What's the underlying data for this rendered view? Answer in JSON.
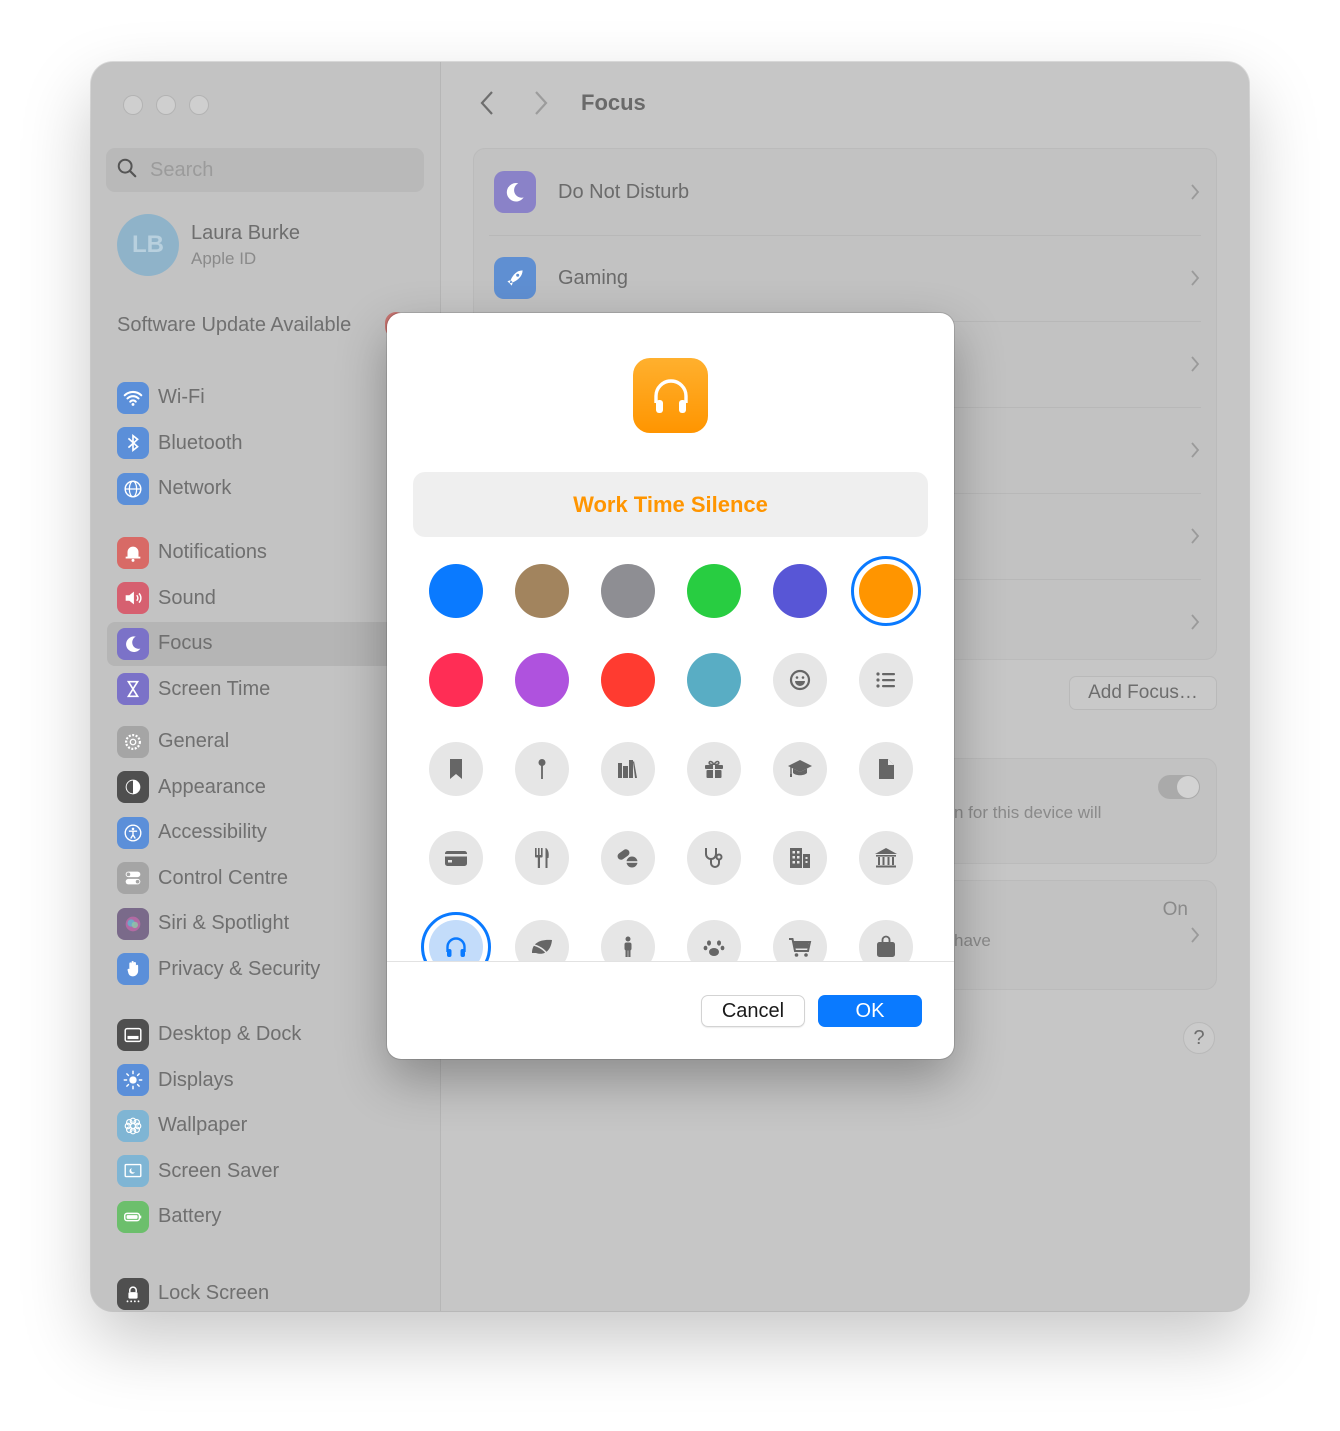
{
  "window": {
    "traffic_lights": [
      "close",
      "minimize",
      "zoom"
    ]
  },
  "sidebar": {
    "search_placeholder": "Search",
    "account": {
      "initials": "LB",
      "name": "Laura Burke",
      "subtitle": "Apple ID"
    },
    "software_update": "Software Update Available",
    "groups": [
      [
        {
          "label": "Wi-Fi",
          "icon": "wifi-icon",
          "color": "#5b8fd9"
        },
        {
          "label": "Bluetooth",
          "icon": "bluetooth-icon",
          "color": "#5b8fd9"
        },
        {
          "label": "Network",
          "icon": "globe-icon",
          "color": "#5b8fd9"
        }
      ],
      [
        {
          "label": "Notifications",
          "icon": "bell-icon",
          "color": "#d86a66"
        },
        {
          "label": "Sound",
          "icon": "speaker-icon",
          "color": "#d66070"
        },
        {
          "label": "Focus",
          "icon": "moon-icon",
          "color": "#7b72c8",
          "active": true
        },
        {
          "label": "Screen Time",
          "icon": "hourglass-icon",
          "color": "#7b72c8"
        }
      ],
      [
        {
          "label": "General",
          "icon": "gear-icon",
          "color": "#a5a5a5"
        },
        {
          "label": "Appearance",
          "icon": "appearance-icon",
          "color": "#4f4f4f"
        },
        {
          "label": "Accessibility",
          "icon": "accessibility-icon",
          "color": "#5b8fd9"
        },
        {
          "label": "Control Centre",
          "icon": "switches-icon",
          "color": "#a5a5a5"
        },
        {
          "label": "Siri & Spotlight",
          "icon": "siri-icon",
          "color": "#7a6a8a"
        },
        {
          "label": "Privacy & Security",
          "icon": "hand-icon",
          "color": "#5b8fd9"
        }
      ],
      [
        {
          "label": "Desktop & Dock",
          "icon": "dock-icon",
          "color": "#4f4f4f"
        },
        {
          "label": "Displays",
          "icon": "sun-icon",
          "color": "#5b8fd9"
        },
        {
          "label": "Wallpaper",
          "icon": "flower-icon",
          "color": "#7fb5d4"
        },
        {
          "label": "Screen Saver",
          "icon": "screensaver-icon",
          "color": "#7fb5d4"
        },
        {
          "label": "Battery",
          "icon": "battery-icon",
          "color": "#6cbf6c"
        }
      ],
      [
        {
          "label": "Lock Screen",
          "icon": "lock-icon",
          "color": "#4f4f4f"
        }
      ]
    ]
  },
  "content": {
    "title": "Focus",
    "focus_items": [
      {
        "label": "Do Not Disturb",
        "icon": "moon-icon",
        "color": "#8a82c8"
      },
      {
        "label": "Gaming",
        "icon": "rocket-icon",
        "color": "#5f8fd2"
      },
      {
        "label": "",
        "icon": "",
        "color": ""
      },
      {
        "label": "",
        "icon": "",
        "color": ""
      },
      {
        "label": "",
        "icon": "",
        "color": ""
      },
      {
        "label": "",
        "icon": "",
        "color": ""
      }
    ],
    "add_focus_label": "Add Focus…",
    "share_text": "n for this device will",
    "status_value": "On",
    "status_text": "have",
    "help_label": "?"
  },
  "modal": {
    "selected_icon": "headphones-icon",
    "accent_color": "#ff9500",
    "name_value": "Work Time Silence",
    "colors": [
      {
        "name": "blue",
        "hex": "#0a7aff"
      },
      {
        "name": "brown",
        "hex": "#a2845e"
      },
      {
        "name": "gray",
        "hex": "#8e8e93"
      },
      {
        "name": "green",
        "hex": "#28cd41"
      },
      {
        "name": "indigo",
        "hex": "#5856d6"
      },
      {
        "name": "orange",
        "hex": "#ff9500",
        "selected": true
      },
      {
        "name": "pink",
        "hex": "#ff2d55"
      },
      {
        "name": "purple",
        "hex": "#af52de"
      },
      {
        "name": "red",
        "hex": "#ff3b30"
      },
      {
        "name": "teal",
        "hex": "#59adc4"
      }
    ],
    "symbols": [
      "smiley-icon",
      "list-icon",
      "bookmark-icon",
      "pin-icon",
      "books-icon",
      "gift-icon",
      "graduation-cap-icon",
      "document-icon",
      "credit-card-icon",
      "fork-knife-icon",
      "pills-icon",
      "stethoscope-icon",
      "building-icon",
      "bank-icon",
      "headphones-icon",
      "leaf-icon",
      "person-icon",
      "paw-icon",
      "cart-icon",
      "bag-icon"
    ],
    "selected_symbol": "headphones-icon",
    "cancel_label": "Cancel",
    "ok_label": "OK"
  }
}
